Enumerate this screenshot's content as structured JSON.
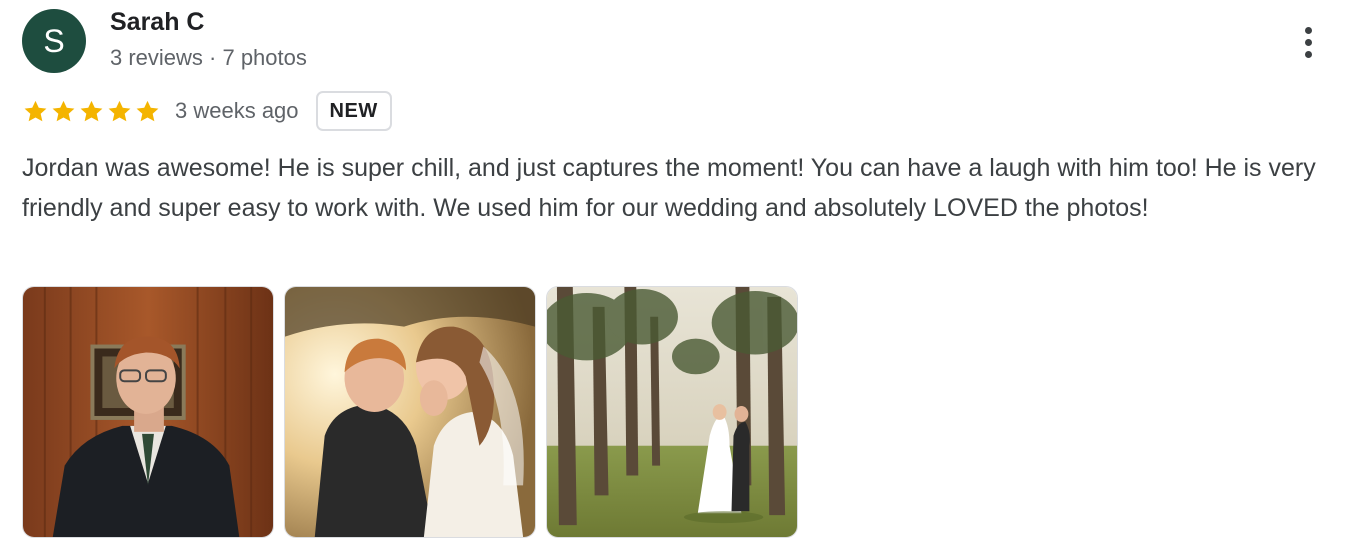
{
  "author": {
    "initial": "S",
    "name": "Sarah C",
    "meta": "3 reviews · 7 photos",
    "avatar_color": "#1e4d3f"
  },
  "menu": {
    "icon": "more-vert-icon"
  },
  "rating": {
    "stars": 5,
    "max": 5,
    "star_color": "#f4b400",
    "time": "3 weeks ago",
    "badge": "NEW"
  },
  "review": {
    "text": "Jordan was awesome! He is super chill, and just captures the moment! You can have a laugh with him too! He is very friendly and super easy to work with. We used him for our wedding and absolutely LOVED the photos!"
  },
  "photos": [
    {
      "subject": "groom-portrait"
    },
    {
      "subject": "couple-kissing-sunlight"
    },
    {
      "subject": "couple-among-trees"
    }
  ]
}
